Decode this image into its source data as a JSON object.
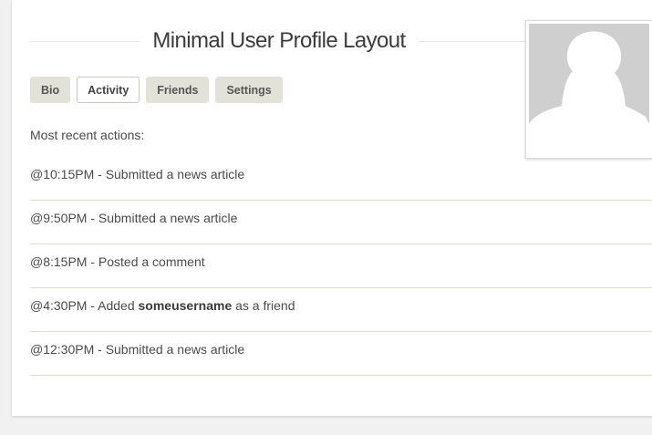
{
  "page": {
    "title": "Minimal User Profile Layout"
  },
  "tabs": [
    {
      "label": "Bio"
    },
    {
      "label": "Activity"
    },
    {
      "label": "Friends"
    },
    {
      "label": "Settings"
    }
  ],
  "active_tab": "Activity",
  "activity": {
    "heading": "Most recent actions:",
    "items": [
      {
        "text": "@10:15PM - Submitted a news article"
      },
      {
        "text": "@9:50PM - Submitted a news article"
      },
      {
        "text": "@8:15PM - Posted a comment"
      },
      {
        "prefix": "@4:30PM - Added ",
        "username": "someusername",
        "suffix": " as a friend"
      },
      {
        "text": "@12:30PM - Submitted a news article"
      }
    ]
  },
  "avatar": {
    "icon": "default-user-silhouette-icon"
  },
  "colors": {
    "background": "#f1f1f1",
    "tab_background": "#e3e2d9",
    "divider": "#d8d9c6",
    "avatar_placeholder": "#cfcfcf"
  }
}
